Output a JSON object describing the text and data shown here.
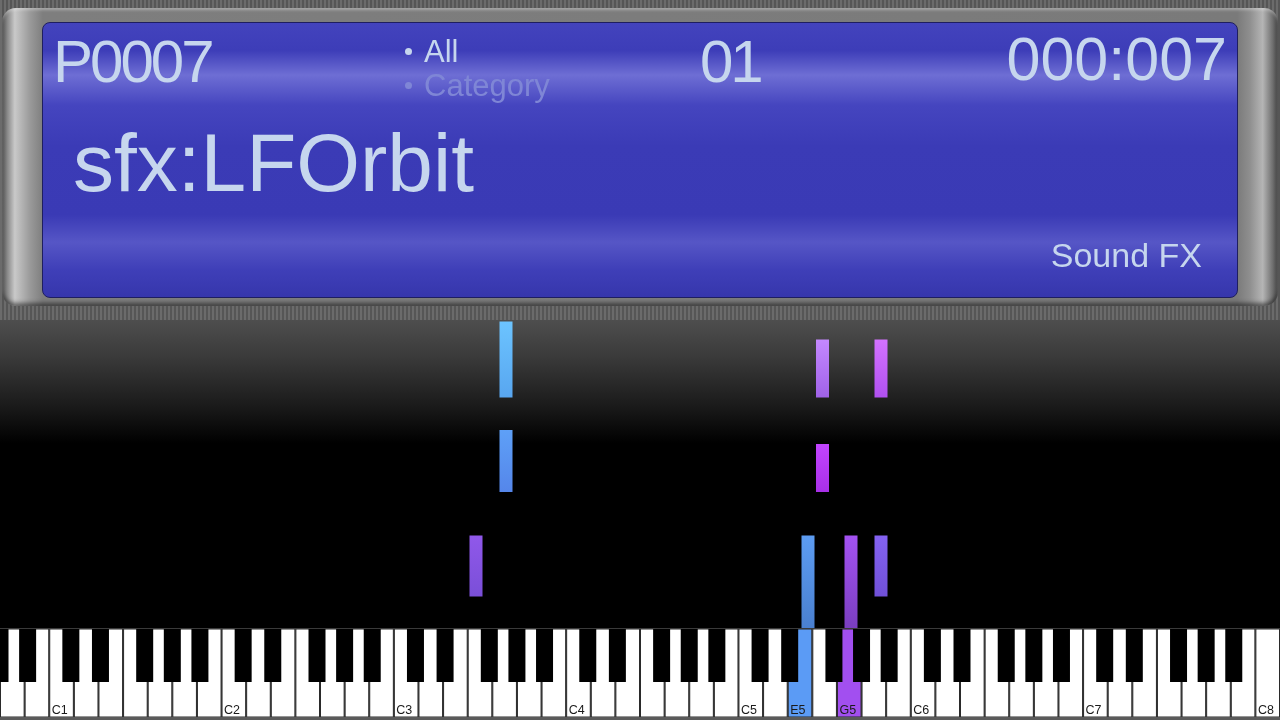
{
  "display": {
    "program_number": "P0007",
    "filters": [
      {
        "label": "All",
        "selected": true
      },
      {
        "label": "Category",
        "selected": false
      }
    ],
    "channel": "01",
    "position": "000:007",
    "program_name": "sfx:LFOrbit",
    "category": "Sound FX"
  },
  "keyboard": {
    "white_keys": [
      {
        "pressed": false
      },
      {
        "pressed": false
      },
      {
        "label": "C1",
        "pressed": false
      },
      {
        "pressed": false
      },
      {
        "pressed": false
      },
      {
        "pressed": false
      },
      {
        "pressed": false
      },
      {
        "pressed": false
      },
      {
        "pressed": false
      },
      {
        "label": "C2",
        "pressed": false
      },
      {
        "pressed": false
      },
      {
        "pressed": false
      },
      {
        "pressed": false
      },
      {
        "pressed": false
      },
      {
        "pressed": false
      },
      {
        "pressed": false
      },
      {
        "label": "C3",
        "pressed": false
      },
      {
        "pressed": false
      },
      {
        "pressed": false
      },
      {
        "pressed": false
      },
      {
        "pressed": false
      },
      {
        "pressed": false
      },
      {
        "pressed": false
      },
      {
        "label": "C4",
        "pressed": false
      },
      {
        "pressed": false
      },
      {
        "pressed": false
      },
      {
        "pressed": false
      },
      {
        "pressed": false
      },
      {
        "pressed": false
      },
      {
        "pressed": false
      },
      {
        "label": "C5",
        "pressed": false
      },
      {
        "pressed": false
      },
      {
        "label": "E5",
        "pressed": true,
        "color": "#5b9bf5"
      },
      {
        "pressed": false
      },
      {
        "label": "G5",
        "pressed": true,
        "color": "#a24ff0"
      },
      {
        "pressed": false
      },
      {
        "pressed": false
      },
      {
        "label": "C6",
        "pressed": false
      },
      {
        "pressed": false
      },
      {
        "pressed": false
      },
      {
        "pressed": false
      },
      {
        "pressed": false
      },
      {
        "pressed": false
      },
      {
        "pressed": false
      },
      {
        "label": "C7",
        "pressed": false
      },
      {
        "pressed": false
      },
      {
        "pressed": false
      },
      {
        "pressed": false
      },
      {
        "pressed": false
      },
      {
        "pressed": false
      },
      {
        "pressed": false
      },
      {
        "label": "C8",
        "pressed": false
      }
    ]
  }
}
